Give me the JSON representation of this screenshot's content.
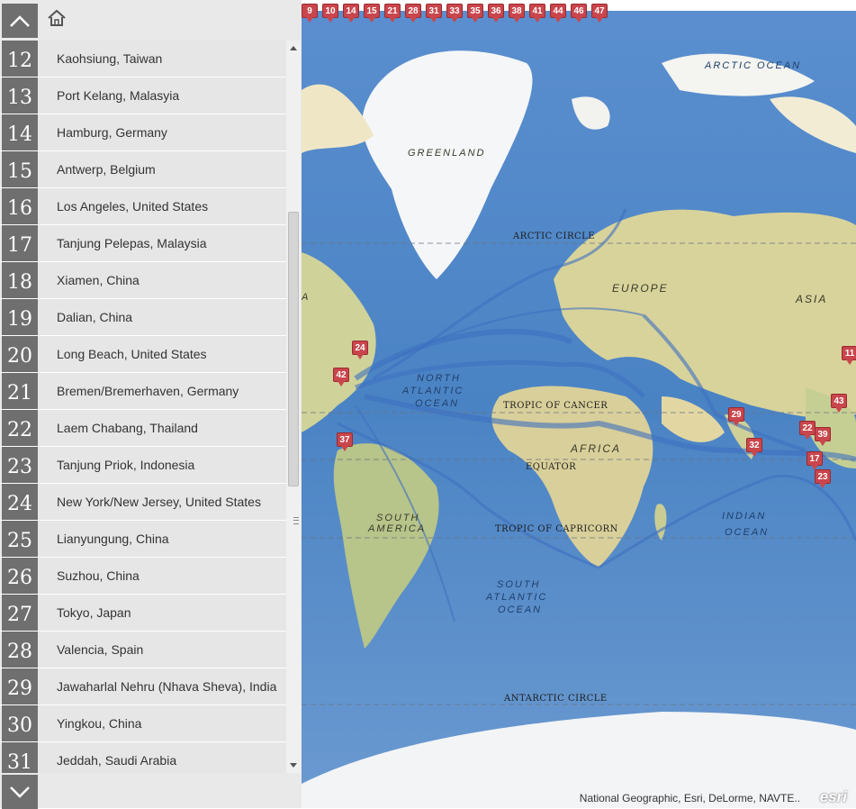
{
  "list": [
    {
      "num": "12",
      "label": "Kaohsiung, Taiwan"
    },
    {
      "num": "13",
      "label": "Port Kelang, Malasyia"
    },
    {
      "num": "14",
      "label": "Hamburg, Germany"
    },
    {
      "num": "15",
      "label": "Antwerp, Belgium"
    },
    {
      "num": "16",
      "label": "Los Angeles, United States"
    },
    {
      "num": "17",
      "label": "Tanjung Pelepas, Malaysia"
    },
    {
      "num": "18",
      "label": "Xiamen, China"
    },
    {
      "num": "19",
      "label": "Dalian, China"
    },
    {
      "num": "20",
      "label": "Long Beach, United States"
    },
    {
      "num": "21",
      "label": "Bremen/Bremerhaven, Germany"
    },
    {
      "num": "22",
      "label": "Laem Chabang, Thailand"
    },
    {
      "num": "23",
      "label": "Tanjung Priok, Indonesia"
    },
    {
      "num": "24",
      "label": "New York/New Jersey, United States"
    },
    {
      "num": "25",
      "label": "Lianyungung, China"
    },
    {
      "num": "26",
      "label": "Suzhou, China"
    },
    {
      "num": "27",
      "label": "Tokyo, Japan"
    },
    {
      "num": "28",
      "label": "Valencia, Spain"
    },
    {
      "num": "29",
      "label": "Jawaharlal Nehru (Nhava Sheva), India"
    },
    {
      "num": "30",
      "label": "Yingkou, China"
    },
    {
      "num": "31",
      "label": "Jeddah, Saudi Arabia"
    }
  ],
  "icons": {
    "up": "chevron-up-icon",
    "down": "chevron-down-icon",
    "home": "home-icon"
  },
  "map": {
    "labels": {
      "arctic_ocean": "ARCTIC OCEAN",
      "greenland": "GREENLAND",
      "europe": "EUROPE",
      "asia": "ASIA",
      "north_atlantic_1": "NORTH",
      "north_atlantic_2": "ATLANTIC",
      "north_atlantic_3": "OCEAN",
      "africa": "AFRICA",
      "south_america_1": "SOUTH",
      "south_america_2": "AMERICA",
      "indian_ocean_1": "INDIAN",
      "indian_ocean_2": "OCEAN",
      "south_atlantic_1": "SOUTH",
      "south_atlantic_2": "ATLANTIC",
      "south_atlantic_3": "OCEAN",
      "arctic_circle": "ARCTIC CIRCLE",
      "tropic_cancer": "TROPIC OF CANCER",
      "equator": "EQUATOR",
      "tropic_capricorn": "TROPIC OF CAPRICORN",
      "antarctic_circle": "ANTARCTIC CIRCLE",
      "edge_a": "A"
    },
    "top_pins": [
      "9",
      "10",
      "14",
      "15",
      "21",
      "28",
      "31",
      "33",
      "35",
      "36",
      "38",
      "41",
      "44",
      "46",
      "47"
    ],
    "pins": [
      "24",
      "42",
      "37",
      "29",
      "32",
      "22",
      "39",
      "17",
      "23",
      "43",
      "11"
    ],
    "attribution": "National Geographic, Esri, DeLorme, NAVTE..",
    "logo": "esri"
  },
  "colors": {
    "sidebar_badge": "#6f6f6f",
    "pin": "#c9464c",
    "ocean": "#4f86c6",
    "land": "#d9cf9a"
  }
}
